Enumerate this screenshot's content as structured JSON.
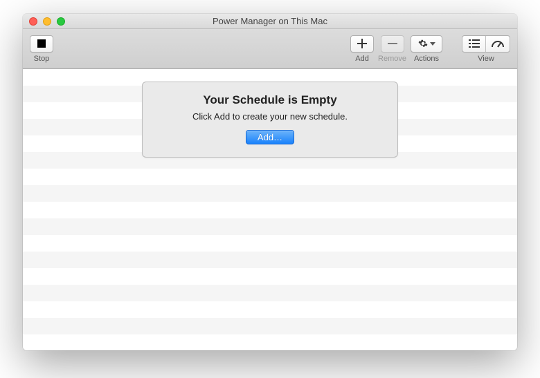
{
  "window": {
    "title": "Power Manager on This Mac"
  },
  "toolbar": {
    "stop_label": "Stop",
    "add_label": "Add",
    "remove_label": "Remove",
    "actions_label": "Actions",
    "view_label": "View"
  },
  "empty": {
    "title": "Your Schedule is Empty",
    "subtitle": "Click Add to create your new schedule.",
    "button": "Add…"
  }
}
